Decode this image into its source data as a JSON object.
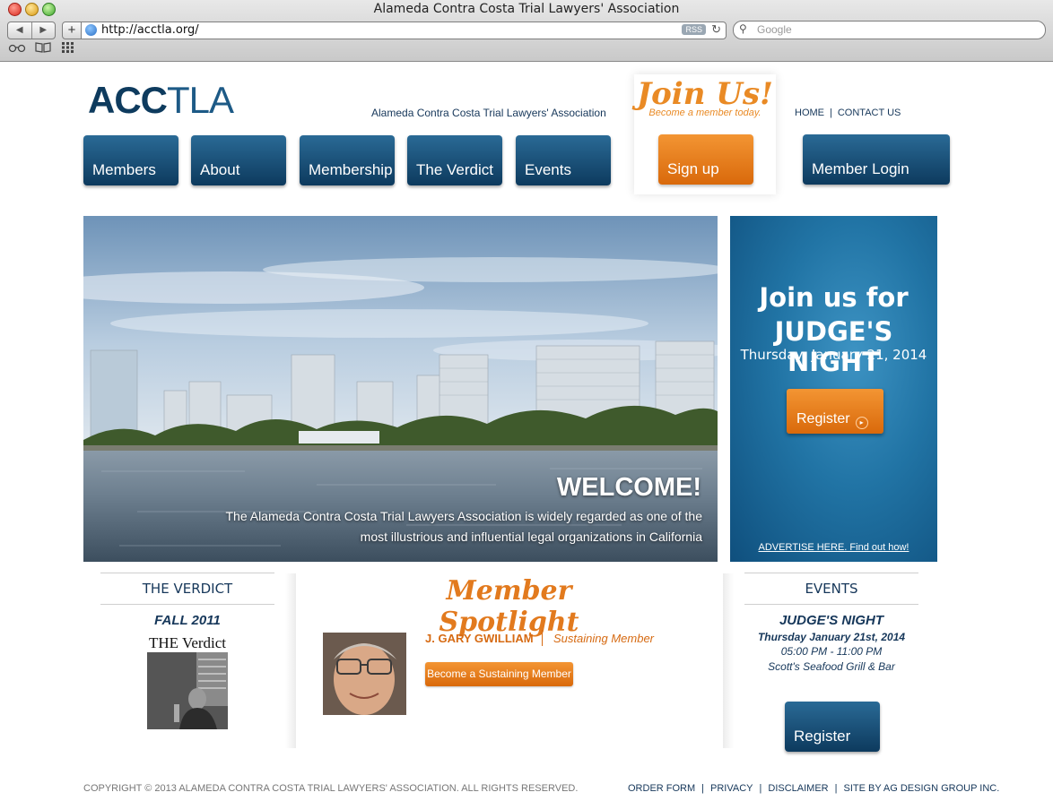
{
  "browser": {
    "window_title": "Alameda Contra Costa Trial Lawyers' Association",
    "url": "http://acctla.org/",
    "rss_label": "RSS",
    "search_placeholder": "Google",
    "back_glyph": "◀",
    "forward_glyph": "▶",
    "add_glyph": "+",
    "reload_glyph": "↻"
  },
  "header": {
    "logo_part1": "ACC",
    "logo_part2": "TLA",
    "tagline": "Alameda Contra Costa Trial Lawyers' Association",
    "nav": [
      "Members",
      "About",
      "Membership",
      "The Verdict",
      "Events"
    ],
    "join_title": "Join Us!",
    "join_subtitle": "Become a member today.",
    "signup_label": "Sign up",
    "top_links": [
      "HOME",
      "CONTACT US"
    ],
    "top_links_separator": "|",
    "login_label": "Member Login"
  },
  "hero": {
    "heading": "WELCOME!",
    "text": "The Alameda Contra Costa Trial Lawyers Association is widely regarded as one of the most illustrious and influential legal organizations in California"
  },
  "side_ad": {
    "line1": "Join us for",
    "line2": "JUDGE'S NIGHT",
    "date": "Thursday,  January 21, 2014",
    "button_label": "Register",
    "advertise": "ADVERTISE HERE. Find out how!"
  },
  "verdict": {
    "heading": "THE VERDICT",
    "issue": "FALL 2011",
    "magazine_title": "THE Verdict"
  },
  "spotlight": {
    "title": "Member Spotlight",
    "member_name": "J. GARY GWILLIAM",
    "member_type": "Sustaining Member",
    "button_label": "Become a Sustaining Member"
  },
  "events": {
    "heading": "EVENTS",
    "name": "JUDGE'S NIGHT",
    "date": "Thursday January 21st, 2014",
    "time": "05:00 PM - 11:00 PM",
    "venue": "Scott's Seafood Grill & Bar",
    "button_label": "Register"
  },
  "footer": {
    "copyright": "COPYRIGHT © 2013 ALAMEDA CONTRA COSTA TRIAL LAWYERS' ASSOCIATION. ALL RIGHTS RESERVED.",
    "links": [
      "ORDER FORM",
      "PRIVACY",
      "DISCLAIMER",
      "SITE BY AG DESIGN GROUP INC."
    ],
    "links_separator": "|"
  },
  "colors": {
    "brand_blue": "#0e3b5e",
    "accent_orange": "#e98a25"
  },
  "icons": [
    "globe-icon",
    "rss-icon",
    "reload-icon",
    "search-icon",
    "reading-list-icon",
    "bookmarks-icon",
    "top-sites-icon",
    "arrow-circle-icon"
  ]
}
